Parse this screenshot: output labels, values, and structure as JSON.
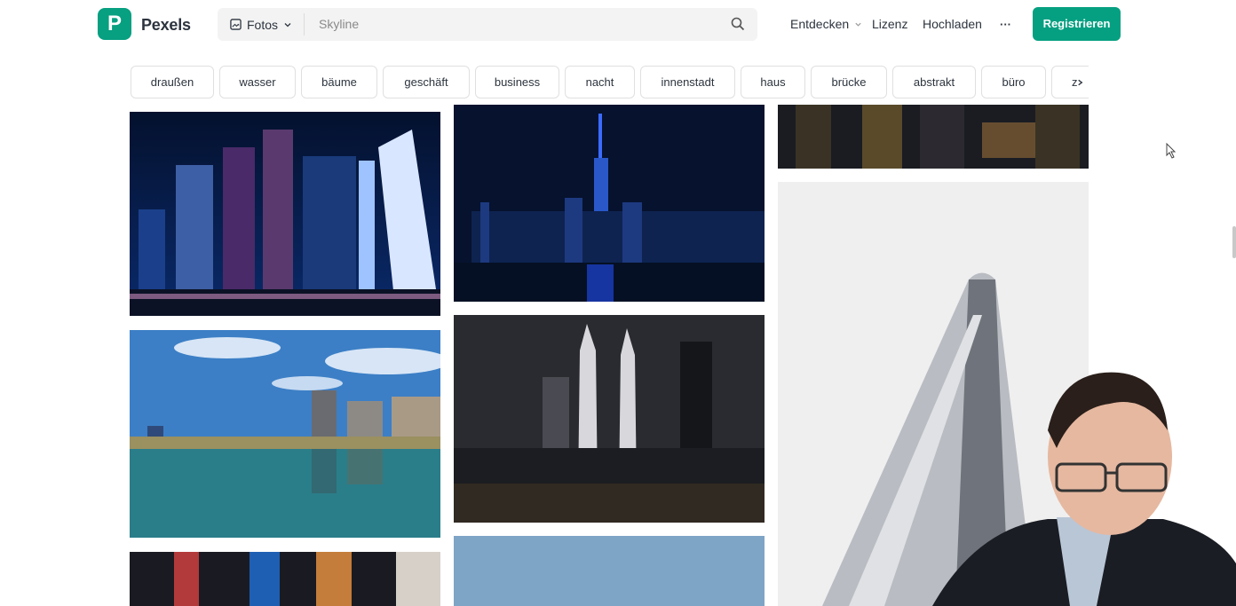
{
  "header": {
    "brand": "Pexels",
    "search_type": "Fotos",
    "search_query": "Skyline",
    "nav": {
      "discover": "Entdecken",
      "license": "Lizenz",
      "upload": "Hochladen",
      "more": "···"
    },
    "register": "Registrieren"
  },
  "tags": [
    "draußen",
    "wasser",
    "bäume",
    "geschäft",
    "business",
    "nacht",
    "innenstadt",
    "haus",
    "brücke",
    "abstrakt",
    "büro",
    "z"
  ],
  "colors": {
    "brand": "#05a081",
    "text": "#2c343e"
  }
}
